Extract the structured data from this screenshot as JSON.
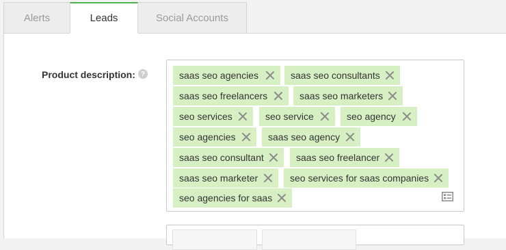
{
  "tabs": [
    {
      "label": "Alerts",
      "active": false
    },
    {
      "label": "Leads",
      "active": true
    },
    {
      "label": "Social Accounts",
      "active": false
    }
  ],
  "form": {
    "product_description_label": "Product description:",
    "help_icon": "question-mark-icon",
    "tags": [
      "saas seo agencies",
      "saas seo consultants",
      "saas seo freelancers",
      "saas seo marketers",
      "seo services",
      "seo service",
      "seo agency",
      "seo agencies",
      "saas seo agency",
      "saas seo consultant",
      "saas seo freelancer",
      "saas seo marketer",
      "seo services for saas companies",
      "seo agencies for saas"
    ],
    "bulk_edit_icon": "list-view-icon"
  },
  "colors": {
    "accent": "#4cb54c",
    "tag_bg": "#d6f0c4"
  }
}
